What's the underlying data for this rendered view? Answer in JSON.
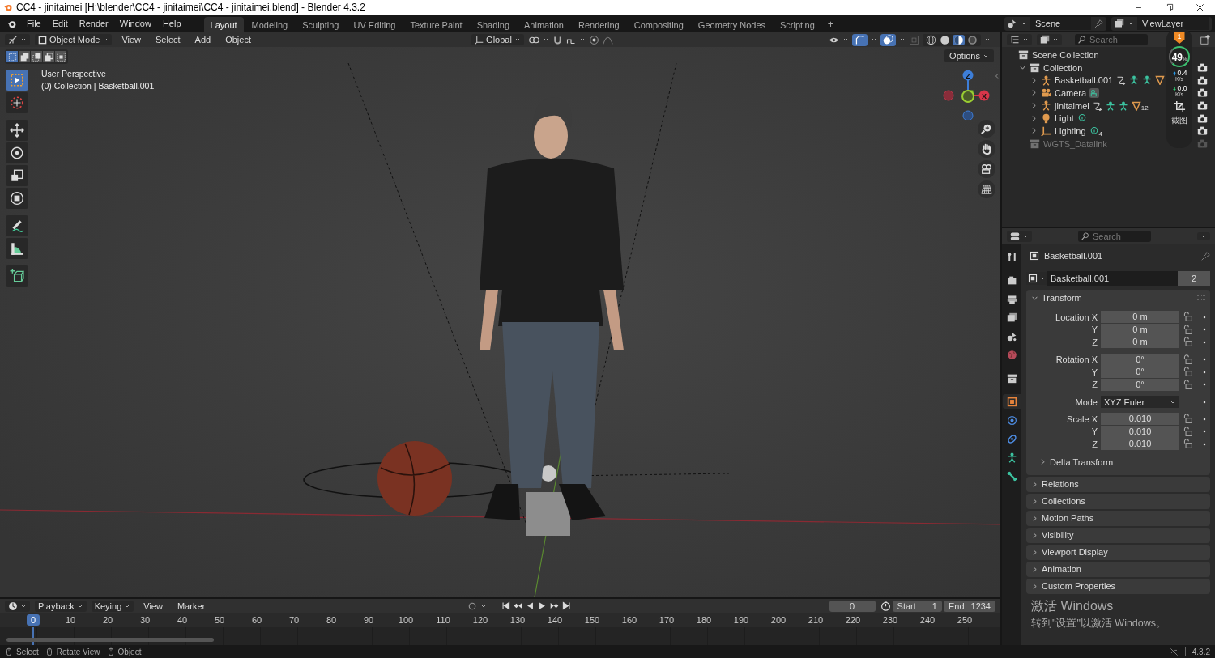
{
  "window": {
    "title": "CC4 - jinitaimei [H:\\blender\\CC4 - jinitaimei\\CC4 - jinitaimei.blend] - Blender 4.3.2"
  },
  "menu": [
    "File",
    "Edit",
    "Render",
    "Window",
    "Help"
  ],
  "workspaces": [
    {
      "label": "Layout",
      "selected": true
    },
    {
      "label": "Modeling",
      "selected": false
    },
    {
      "label": "Sculpting",
      "selected": false
    },
    {
      "label": "UV Editing",
      "selected": false
    },
    {
      "label": "Texture Paint",
      "selected": false
    },
    {
      "label": "Shading",
      "selected": false
    },
    {
      "label": "Animation",
      "selected": false
    },
    {
      "label": "Rendering",
      "selected": false
    },
    {
      "label": "Compositing",
      "selected": false
    },
    {
      "label": "Geometry Nodes",
      "selected": false
    },
    {
      "label": "Scripting",
      "selected": false
    }
  ],
  "add_workspace": "+",
  "scene": "Scene",
  "view_layer": "ViewLayer",
  "viewport": {
    "mode": "Object Mode",
    "menus": [
      "View",
      "Select",
      "Add",
      "Object"
    ],
    "orientation": "Global",
    "options": "Options",
    "shading": [
      {
        "kind": "wireframe",
        "selected": false
      },
      {
        "kind": "solid",
        "selected": false
      },
      {
        "kind": "material",
        "selected": true
      },
      {
        "kind": "rendered",
        "selected": false
      }
    ],
    "select_modes": [
      {
        "kind": "set",
        "selected": true
      },
      {
        "kind": "extend",
        "selected": false
      },
      {
        "kind": "subtract",
        "selected": false
      },
      {
        "kind": "invert",
        "selected": false
      },
      {
        "kind": "intersect",
        "selected": false
      }
    ],
    "overlay_text": [
      "User Perspective",
      "(0) Collection | Basketball.001"
    ],
    "tools": [
      {
        "kind": "select",
        "selected": true
      },
      {
        "kind": "cursor",
        "selected": false
      },
      {
        "kind": "move",
        "selected": false
      },
      {
        "kind": "rotate",
        "selected": false
      },
      {
        "kind": "scale",
        "selected": false
      },
      {
        "kind": "transform",
        "selected": false
      },
      {
        "kind": "annotate",
        "selected": false
      },
      {
        "kind": "measure",
        "selected": false
      },
      {
        "kind": "add_cube",
        "selected": false
      }
    ],
    "gizmo": {
      "z": "Z",
      "x": "X"
    }
  },
  "outliner": {
    "search": {
      "placeholder": "Search"
    },
    "tree": [
      {
        "label": "Scene Collection",
        "kind": "scene_collection",
        "children": [
          {
            "label": "Collection",
            "kind": "collection",
            "expanded": true,
            "children": [
              {
                "label": "Basketball.001",
                "kind": "armature",
                "expanded": false
              },
              {
                "label": "Camera",
                "kind": "camera",
                "expanded": false
              },
              {
                "label": "jinitaimei",
                "kind": "armature",
                "expanded": false,
                "badge": "12"
              },
              {
                "label": "Light",
                "kind": "light",
                "expanded": false
              },
              {
                "label": "Lighting",
                "kind": "empty",
                "expanded": false,
                "badge": "4"
              }
            ]
          },
          {
            "label": "WGTS_Datalink",
            "kind": "collection",
            "disabled": true
          }
        ]
      }
    ]
  },
  "net_monitor": {
    "badge": "1",
    "percent": "49",
    "percent_unit": "%",
    "up": "0.4",
    "up_unit": "K/s",
    "down": "0.0",
    "down_unit": "K/s",
    "screenshot": "截图"
  },
  "properties": {
    "search": {
      "placeholder": "Search"
    },
    "tabs": [
      {
        "kind": "tool",
        "selected": false
      },
      {
        "kind": "render",
        "selected": false
      },
      {
        "kind": "output",
        "selected": false
      },
      {
        "kind": "view_layer",
        "selected": false
      },
      {
        "kind": "scene",
        "selected": false
      },
      {
        "kind": "world",
        "selected": false
      },
      {
        "kind": "collection",
        "selected": false
      },
      {
        "kind": "object",
        "selected": true
      },
      {
        "kind": "physics",
        "selected": false
      },
      {
        "kind": "constraints",
        "selected": false
      },
      {
        "kind": "data",
        "selected": false
      },
      {
        "kind": "bone",
        "selected": false
      }
    ],
    "object_name": "Basketball.001",
    "datablock": "Basketball.001",
    "users": "2",
    "transform": {
      "title": "Transform",
      "expanded": true,
      "groups": [
        [
          {
            "label": "Location X",
            "value": "0 m",
            "kind": "number"
          },
          {
            "label": "Y",
            "value": "0 m",
            "kind": "number"
          },
          {
            "label": "Z",
            "value": "0 m",
            "kind": "number"
          }
        ],
        [
          {
            "label": "Rotation X",
            "value": "0°",
            "kind": "number"
          },
          {
            "label": "Y",
            "value": "0°",
            "kind": "number"
          },
          {
            "label": "Z",
            "value": "0°",
            "kind": "number"
          }
        ],
        [
          {
            "label": "Mode",
            "value": "XYZ Euler",
            "kind": "dropdown"
          }
        ],
        [
          {
            "label": "Scale X",
            "value": "0.010",
            "kind": "number"
          },
          {
            "label": "Y",
            "value": "0.010",
            "kind": "number"
          },
          {
            "label": "Z",
            "value": "0.010",
            "kind": "number"
          }
        ]
      ],
      "subpanel": {
        "title": "Delta Transform",
        "expanded": false
      }
    },
    "panels": [
      {
        "title": "Relations",
        "expanded": false
      },
      {
        "title": "Collections",
        "expanded": false
      },
      {
        "title": "Motion Paths",
        "expanded": false
      },
      {
        "title": "Visibility",
        "expanded": false
      },
      {
        "title": "Viewport Display",
        "expanded": false
      },
      {
        "title": "Animation",
        "expanded": false
      },
      {
        "title": "Custom Properties",
        "expanded": false
      }
    ]
  },
  "timeline": {
    "menus": [
      "Playback",
      "Keying",
      "View",
      "Marker"
    ],
    "current_frame": "0",
    "start_label": "Start",
    "start": "1",
    "end_label": "End",
    "end": "1234",
    "playhead": "0",
    "ticks": [
      "10",
      "20",
      "30",
      "40",
      "50",
      "60",
      "70",
      "80",
      "90",
      "100",
      "110",
      "120",
      "130",
      "140",
      "150",
      "160",
      "170",
      "180",
      "190",
      "200",
      "210",
      "220",
      "230",
      "240",
      "250"
    ]
  },
  "status_bar": {
    "hints": [
      "Select",
      "Rotate View",
      "Object"
    ],
    "version": "4.3.2"
  },
  "activation_notice": {
    "title": "激活 Windows",
    "text": "转到\"设置\"以激活 Windows。"
  }
}
